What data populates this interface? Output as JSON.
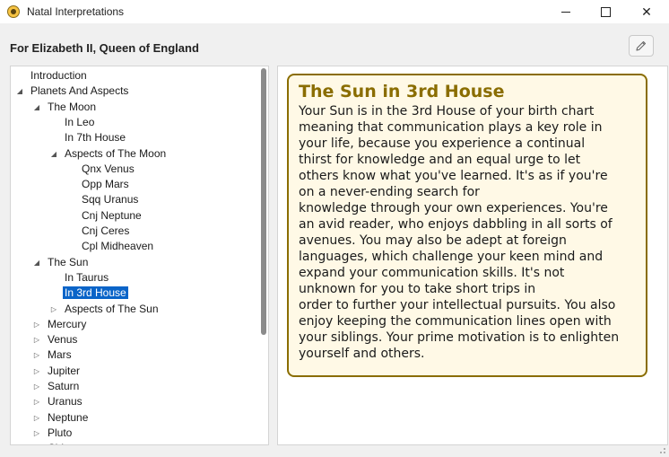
{
  "window": {
    "title": "Natal Interpretations",
    "minimize_glyph": "—",
    "maximize_glyph": "□",
    "close_glyph": "✕"
  },
  "header": {
    "person": "For Elizabeth II, Queen of England"
  },
  "tree": [
    {
      "label": "Introduction",
      "level": 0,
      "toggle": "none"
    },
    {
      "label": "Planets And Aspects",
      "level": 0,
      "toggle": "expanded"
    },
    {
      "label": "The Moon",
      "level": 1,
      "toggle": "expanded"
    },
    {
      "label": "In Leo",
      "level": 2,
      "toggle": "none"
    },
    {
      "label": "In 7th House",
      "level": 2,
      "toggle": "none"
    },
    {
      "label": "Aspects of The Moon",
      "level": 2,
      "toggle": "expanded"
    },
    {
      "label": "Qnx Venus",
      "level": 3,
      "toggle": "none"
    },
    {
      "label": "Opp Mars",
      "level": 3,
      "toggle": "none"
    },
    {
      "label": "Sqq Uranus",
      "level": 3,
      "toggle": "none"
    },
    {
      "label": "Cnj Neptune",
      "level": 3,
      "toggle": "none"
    },
    {
      "label": "Cnj Ceres",
      "level": 3,
      "toggle": "none"
    },
    {
      "label": "Cpl Midheaven",
      "level": 3,
      "toggle": "none"
    },
    {
      "label": "The Sun",
      "level": 1,
      "toggle": "expanded"
    },
    {
      "label": "In Taurus",
      "level": 2,
      "toggle": "none"
    },
    {
      "label": "In 3rd House",
      "level": 2,
      "toggle": "none",
      "selected": true
    },
    {
      "label": "Aspects of The Sun",
      "level": 2,
      "toggle": "collapsed"
    },
    {
      "label": "Mercury",
      "level": 1,
      "toggle": "collapsed"
    },
    {
      "label": "Venus",
      "level": 1,
      "toggle": "collapsed"
    },
    {
      "label": "Mars",
      "level": 1,
      "toggle": "collapsed"
    },
    {
      "label": "Jupiter",
      "level": 1,
      "toggle": "collapsed"
    },
    {
      "label": "Saturn",
      "level": 1,
      "toggle": "collapsed"
    },
    {
      "label": "Uranus",
      "level": 1,
      "toggle": "collapsed"
    },
    {
      "label": "Neptune",
      "level": 1,
      "toggle": "collapsed"
    },
    {
      "label": "Pluto",
      "level": 1,
      "toggle": "collapsed"
    },
    {
      "label": "Chiron",
      "level": 1,
      "toggle": "collapsed"
    }
  ],
  "interpretation": {
    "title": "The Sun in 3rd House",
    "lines": [
      "Your Sun is in the 3rd House of your birth chart",
      "meaning that communication plays a key role in",
      "your life, because you experience a continual",
      "thirst for knowledge and an equal urge to let",
      "others know what you've learned. It's as if you're",
      "on a never-ending search for",
      "knowledge through your own experiences. You're",
      "an avid reader, who enjoys dabbling in all sorts of",
      "avenues. You may also be adept at foreign",
      "languages, which challenge your keen mind and",
      "expand your communication skills. It's not",
      "unknown for you to take short trips in",
      "order to further your intellectual pursuits. You also",
      "enjoy keeping the communication lines open with",
      "your siblings. Your prime motivation is to enlighten",
      "yourself and others."
    ]
  },
  "colors": {
    "selection": "#0a64c8",
    "card_border": "#8a6d00",
    "card_title": "#8a6d00",
    "card_background": "#fff9e6"
  }
}
